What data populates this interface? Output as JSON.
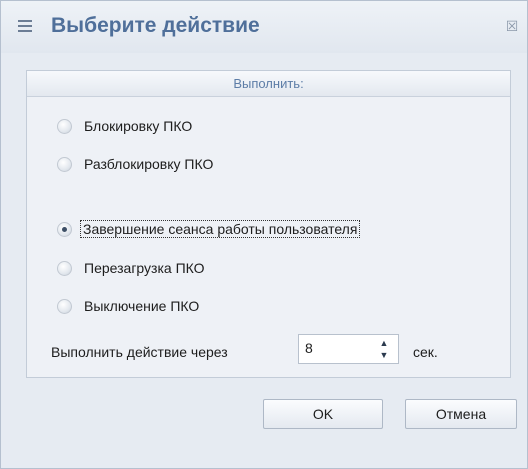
{
  "window": {
    "title": "Выберите действие",
    "menu_icon": "menu-icon",
    "close_icon": "close-icon"
  },
  "group": {
    "title": "Выполнить:"
  },
  "options": [
    {
      "label": "Блокировку ПКО",
      "checked": false
    },
    {
      "label": "Разблокировку ПКО",
      "checked": false
    },
    {
      "label": "Завершение сеанса работы пользователя",
      "checked": true
    },
    {
      "label": "Перезагрузка ПКО",
      "checked": false
    },
    {
      "label": "Выключение ПКО",
      "checked": false
    }
  ],
  "delay": {
    "label": "Выполнить действие через",
    "value": "8",
    "unit": "сек."
  },
  "buttons": {
    "ok": "OK",
    "cancel": "Отмена"
  }
}
